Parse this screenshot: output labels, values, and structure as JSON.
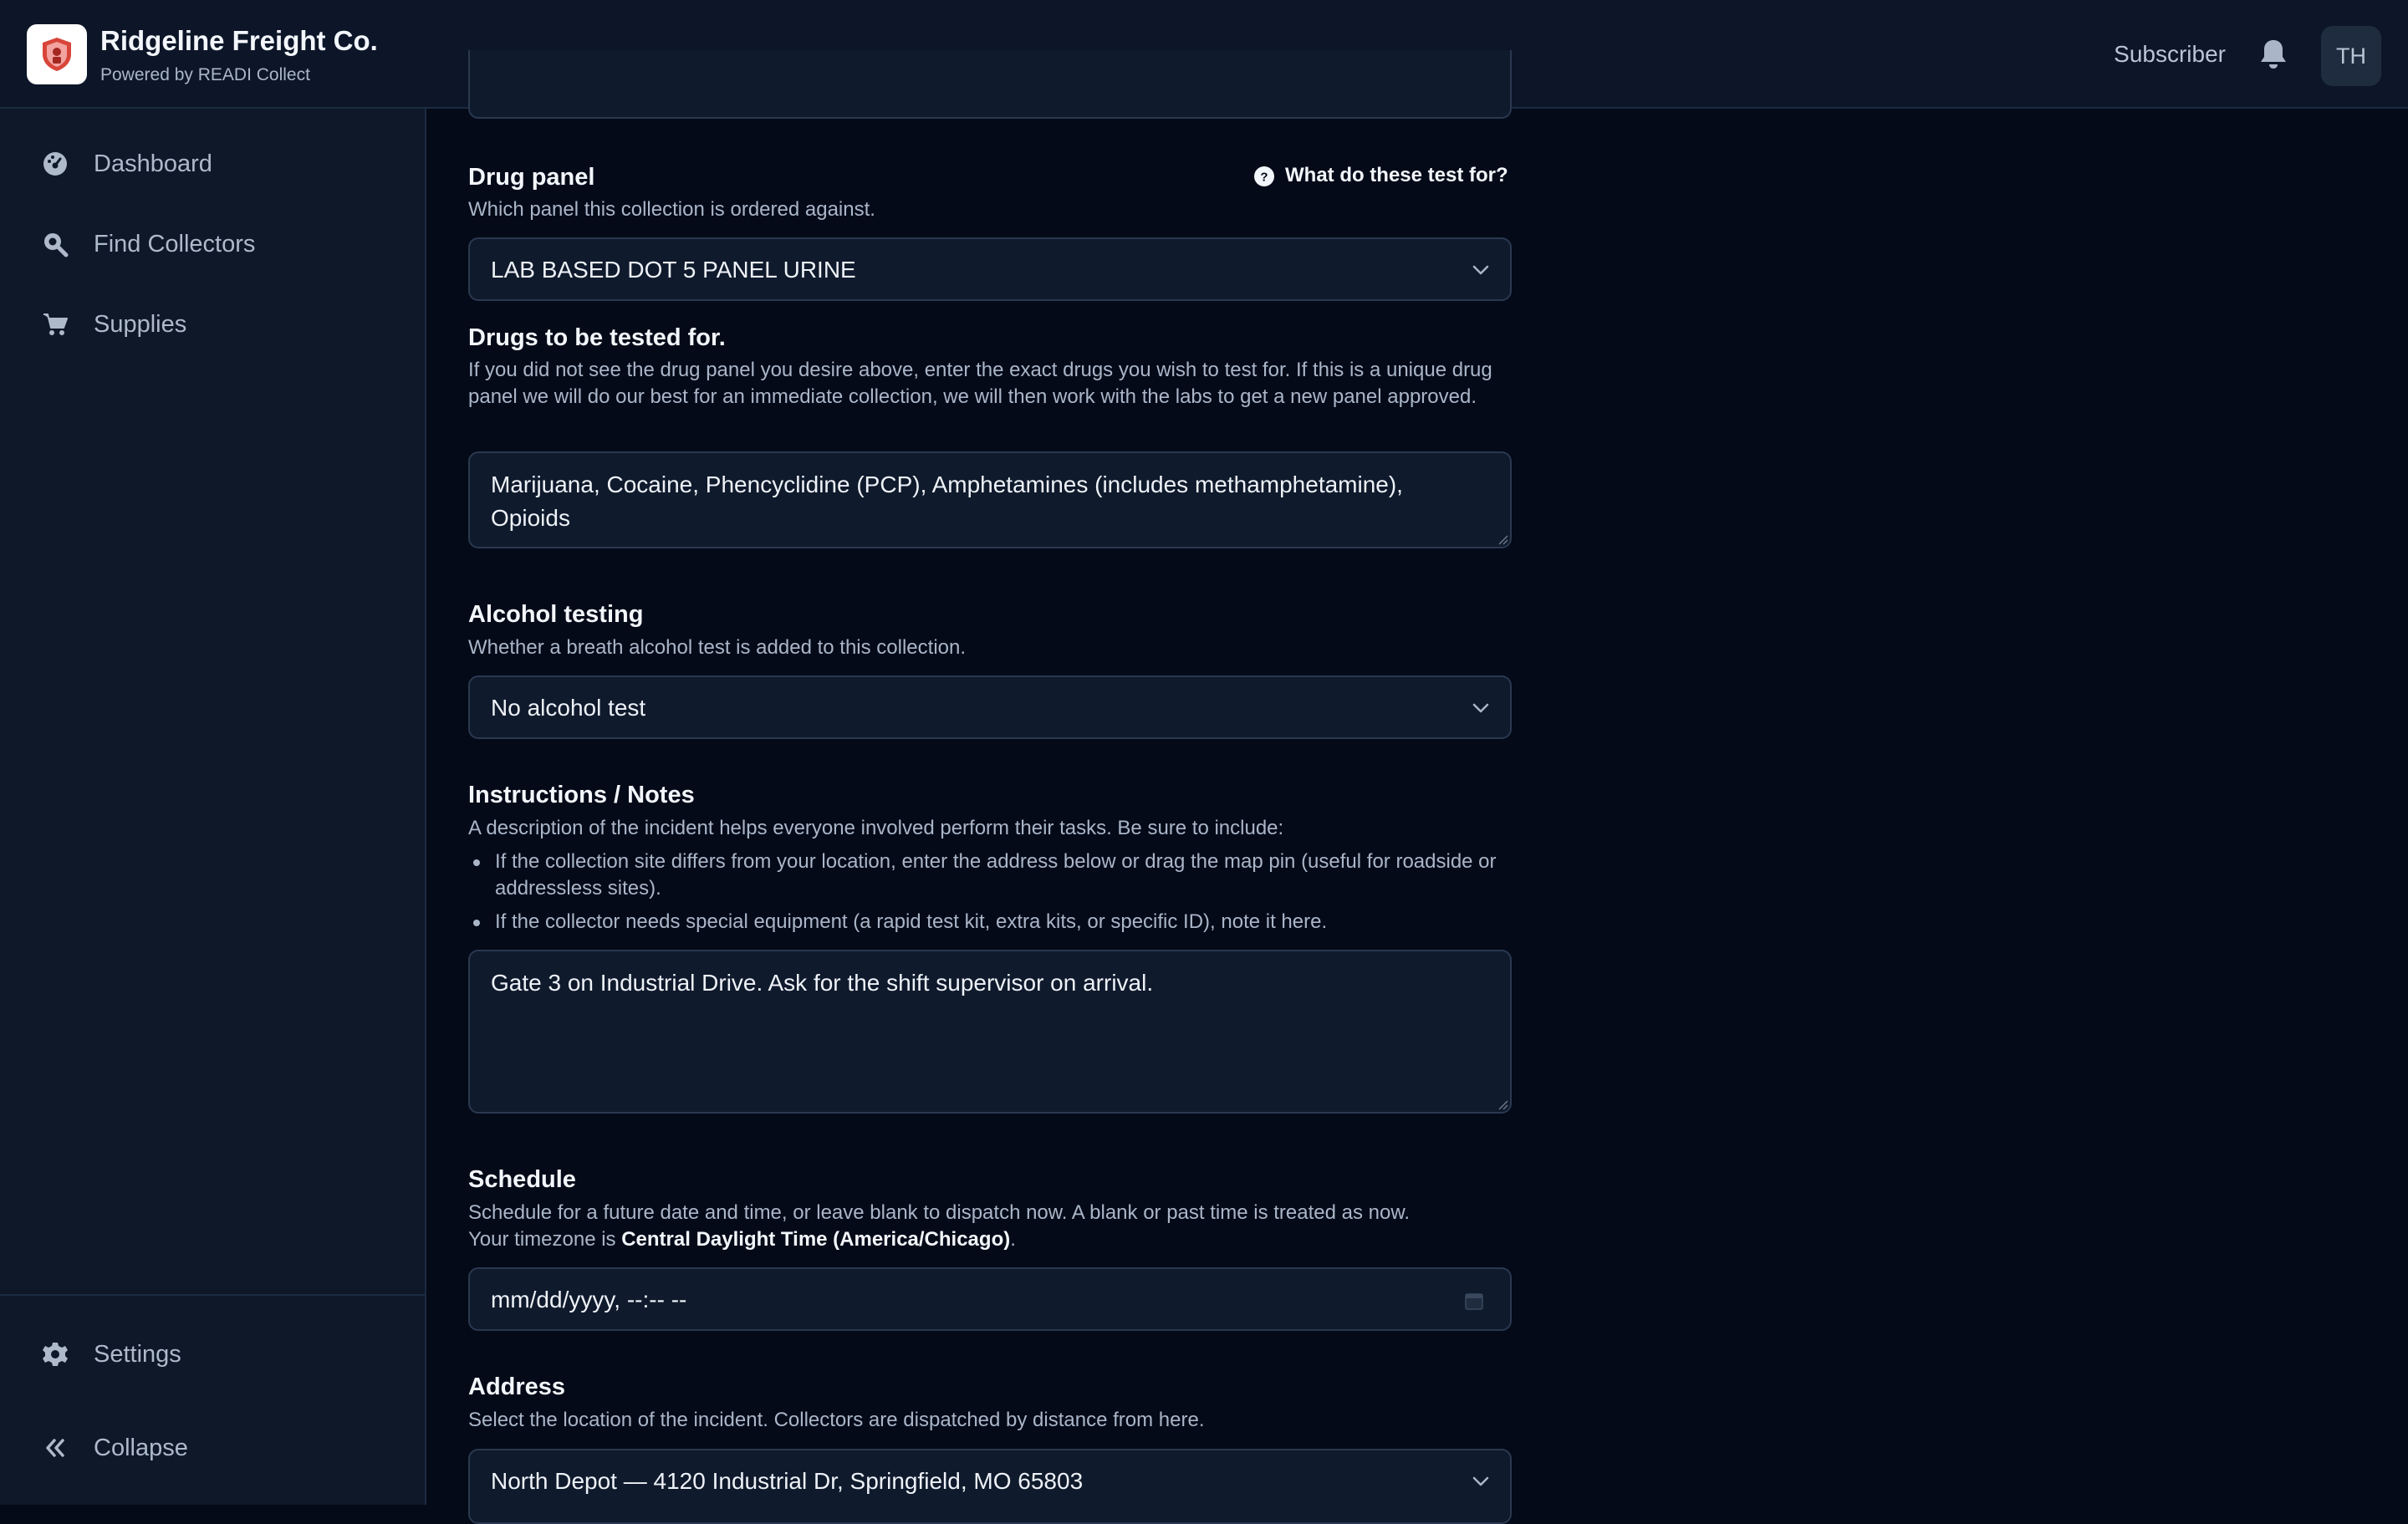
{
  "header": {
    "company_name": "Ridgeline Freight Co.",
    "powered_by": "Powered by READI Collect",
    "role": "Subscriber",
    "avatar_initials": "TH"
  },
  "sidebar": {
    "items": [
      {
        "label": "Dashboard",
        "icon": "dashboard-icon"
      },
      {
        "label": "Find Collectors",
        "icon": "search-icon"
      },
      {
        "label": "Supplies",
        "icon": "cart-icon"
      }
    ],
    "settings_label": "Settings",
    "collapse_label": "Collapse"
  },
  "form": {
    "drug_panel": {
      "label": "Drug panel",
      "description": "Which panel this collection is ordered against.",
      "help_link": "What do these test for?",
      "value": "LAB BASED DOT 5 PANEL URINE"
    },
    "drugs": {
      "label": "Drugs to be tested for.",
      "description": "If you did not see the drug panel you desire above, enter the exact drugs you wish to test for. If this is a unique drug panel we will do our best for an immediate collection, we will then work with the labs to get a new panel approved.",
      "value": "Marijuana, Cocaine, Phencyclidine (PCP), Amphetamines (includes methamphetamine), Opioids"
    },
    "alcohol": {
      "label": "Alcohol testing",
      "description": "Whether a breath alcohol test is added to this collection.",
      "value": "No alcohol test"
    },
    "notes": {
      "label": "Instructions / Notes",
      "description": "A description of the incident helps everyone involved perform their tasks. Be sure to include:",
      "bullets": [
        "If the collection site differs from your location, enter the address below or drag the map pin (useful for roadside or addressless sites).",
        "If the collector needs special equipment (a rapid test kit, extra kits, or specific ID), note it here."
      ],
      "value": "Gate 3 on Industrial Drive. Ask for the shift supervisor on arrival."
    },
    "schedule": {
      "label": "Schedule",
      "description_line1": "Schedule for a future date and time, or leave blank to dispatch now. A blank or past time is treated as now.",
      "timezone_prefix": "Your timezone is ",
      "timezone": "Central Daylight Time (America/Chicago)",
      "timezone_suffix": ".",
      "placeholder": "mm/dd/yyyy, --:-- --"
    },
    "address": {
      "label": "Address",
      "description": "Select the location of the incident. Collectors are dispatched by distance from here.",
      "value": "North Depot — 4120 Industrial Dr, Springfield, MO 65803"
    }
  }
}
